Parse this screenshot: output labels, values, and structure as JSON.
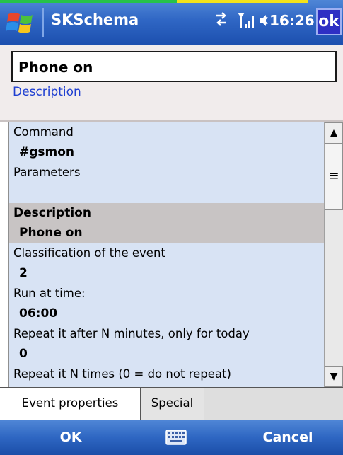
{
  "titlebar": {
    "app_title": "SKSchema",
    "clock": "16:26",
    "ok_label": "ok",
    "icons": [
      "windows-start-flag-icon",
      "connectivity-icon",
      "signal-icon",
      "volume-icon"
    ]
  },
  "header": {
    "name_value": "Phone on",
    "description_link": "Description"
  },
  "properties": [
    {
      "label": "Command",
      "value": "#gsmon",
      "style": "blue"
    },
    {
      "label": "Parameters",
      "value": "",
      "style": "blue"
    },
    {
      "label": "Description",
      "value": "Phone on",
      "style": "gray"
    },
    {
      "label": "Classification of the event",
      "value": "2",
      "style": "blue"
    },
    {
      "label": "Run at time:",
      "value": "06:00",
      "style": "blue"
    },
    {
      "label": "Repeat it after N minutes, only for today",
      "value": "0",
      "style": "blue"
    },
    {
      "label": "Repeat it N times (0 = do not repeat)",
      "value": "",
      "style": "blue"
    }
  ],
  "tabs": [
    {
      "label": "Event properties",
      "active": true
    },
    {
      "label": "Special",
      "active": false
    }
  ],
  "softkeys": {
    "left": "OK",
    "right": "Cancel"
  },
  "colors": {
    "titlebar": "#2f66c4",
    "row_blue": "#d8e3f4",
    "row_gray": "#c8c4c4",
    "link": "#1f3fd1"
  }
}
